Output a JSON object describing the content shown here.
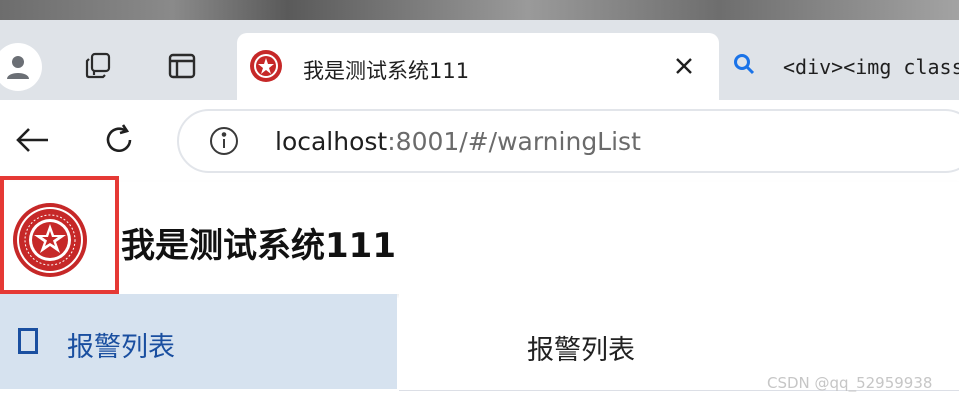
{
  "browser": {
    "active_tab": {
      "title": "我是测试系统111"
    },
    "inactive_tab": {
      "title": "<div><img class"
    },
    "address": {
      "host": "localhost",
      "rest": ":8001/#/warningList"
    }
  },
  "header": {
    "title": "我是测试系统111"
  },
  "sidebar": {
    "items": [
      {
        "label": "报警列表"
      }
    ]
  },
  "main": {
    "tab_label": "报警列表"
  },
  "watermark": "CSDN @qq_52959938",
  "colors": {
    "highlight": "#e53935",
    "sidebar_active_bg": "#d6e2ef",
    "sidebar_active_text": "#1a4fa0",
    "logo_red": "#c62828",
    "search_icon": "#1a73e8"
  },
  "icons": [
    "profile-icon",
    "workspaces-icon",
    "tab-actions-icon",
    "close-icon",
    "search-icon",
    "back-icon",
    "reload-icon",
    "info-icon",
    "square-icon"
  ]
}
